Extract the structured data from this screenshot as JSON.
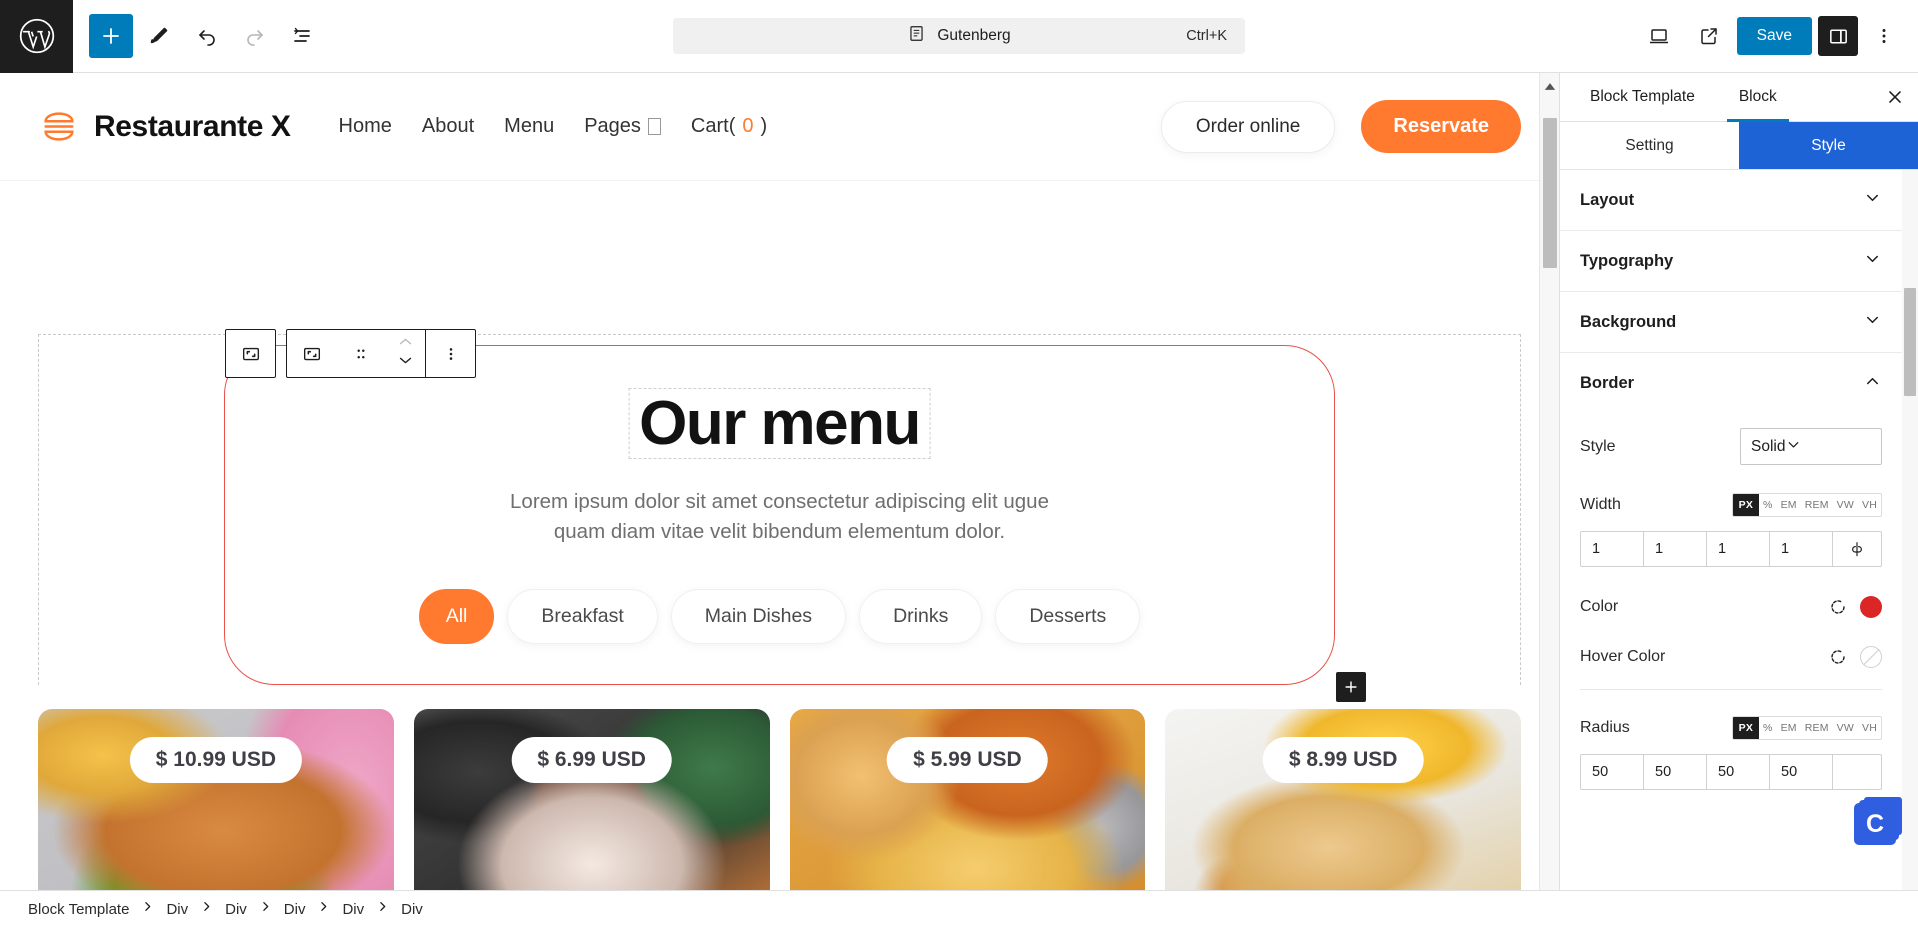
{
  "topbar": {
    "logo_icon": "wordpress-logo-icon",
    "tools": [
      {
        "name": "add-block-button",
        "icon": "plus-icon",
        "state": "primary"
      },
      {
        "name": "edit-tool-button",
        "icon": "pencil-icon",
        "state": "default"
      },
      {
        "name": "undo-button",
        "icon": "undo-arrow-icon",
        "state": "default"
      },
      {
        "name": "redo-button",
        "icon": "redo-arrow-icon",
        "state": "disabled"
      },
      {
        "name": "list-view-button",
        "icon": "list-view-icon",
        "state": "default"
      }
    ],
    "command_bar": {
      "icon": "document-icon",
      "title": "Gutenberg",
      "shortcut": "Ctrl+K"
    },
    "view_icon": "desktop-preview-icon",
    "external_icon": "external-link-icon",
    "save_label": "Save",
    "sidebar_toggle_icon": "sidebar-panel-icon",
    "options_icon": "vertical-dots-icon"
  },
  "block_toolbar": {
    "parent_icon": "select-parent-block-icon",
    "block_icon": "group-block-icon",
    "drag_icon": "drag-handle-icon",
    "move_up_icon": "chevron-up-icon",
    "move_down_icon": "chevron-down-icon",
    "options_icon": "vertical-dots-icon"
  },
  "site": {
    "logo_icon": "burger-logo-icon",
    "brand": "Restaurante X",
    "nav": [
      {
        "label": "Home"
      },
      {
        "label": "About"
      },
      {
        "label": "Menu"
      },
      {
        "label": "Pages",
        "has_dropdown": true
      }
    ],
    "cart_label": "Cart(",
    "cart_count": "0",
    "cart_close": ")",
    "order_button": "Order online",
    "reserve_button": "Reservate"
  },
  "content": {
    "heading": "Our menu",
    "paragraph_line1": "Lorem ipsum dolor sit amet consectetur adipiscing elit ugue",
    "paragraph_line2": "quam diam vitae velit bibendum elementum dolor.",
    "filters": [
      {
        "label": "All",
        "active": true
      },
      {
        "label": "Breakfast",
        "active": false
      },
      {
        "label": "Main Dishes",
        "active": false
      },
      {
        "label": "Drinks",
        "active": false
      },
      {
        "label": "Desserts",
        "active": false
      }
    ],
    "add_block_icon": "plus-icon",
    "cards": [
      {
        "price": "$ 10.99 USD",
        "image": "burger-and-fries-photo"
      },
      {
        "price": "$ 6.99 USD",
        "image": "milkshake-photo"
      },
      {
        "price": "$ 5.99 USD",
        "image": "fried-chicken-and-fries-photo"
      },
      {
        "price": "$ 8.99 USD",
        "image": "pancakes-with-honey-photo"
      }
    ]
  },
  "sidebar": {
    "tabs": [
      {
        "label": "Block Template",
        "active": false
      },
      {
        "label": "Block",
        "active": true
      }
    ],
    "close_icon": "close-icon",
    "segments": [
      {
        "label": "Setting",
        "active": false
      },
      {
        "label": "Style",
        "active": true
      }
    ],
    "panels": [
      {
        "title": "Layout",
        "expanded": false,
        "icon": "chevron-down-icon"
      },
      {
        "title": "Typography",
        "expanded": false,
        "icon": "chevron-down-icon"
      },
      {
        "title": "Background",
        "expanded": false,
        "icon": "chevron-down-icon"
      },
      {
        "title": "Border",
        "expanded": true,
        "icon": "chevron-up-icon"
      }
    ],
    "border": {
      "style_label": "Style",
      "style_value": "Solid",
      "style_caret_icon": "chevron-down-icon",
      "width_label": "Width",
      "width_units": [
        "PX",
        "%",
        "EM",
        "REM",
        "VW",
        "VH"
      ],
      "width_unit_active": "PX",
      "width_values": [
        "1",
        "1",
        "1",
        "1"
      ],
      "width_link_icon": "unlink-sides-icon",
      "color_label": "Color",
      "color_value": "#DC2626",
      "color_reset_icon": "reset-icon",
      "hover_color_label": "Hover Color",
      "hover_color_value": "",
      "hover_color_reset_icon": "reset-icon",
      "radius_label": "Radius",
      "radius_units": [
        "PX",
        "%",
        "EM",
        "REM",
        "VW",
        "VH"
      ],
      "radius_unit_active": "PX",
      "radius_values": [
        "50",
        "50",
        "50",
        "50"
      ]
    },
    "floating_badge": "C"
  },
  "breadcrumb": [
    "Block Template",
    "Div",
    "Div",
    "Div",
    "Div",
    "Div"
  ],
  "colors": {
    "wp_blue": "#007cba",
    "style_tab_blue": "#1e63d6",
    "brand_orange": "#ff7a2f",
    "selection_red": "#e8524a",
    "dark": "#1e1e1e"
  }
}
